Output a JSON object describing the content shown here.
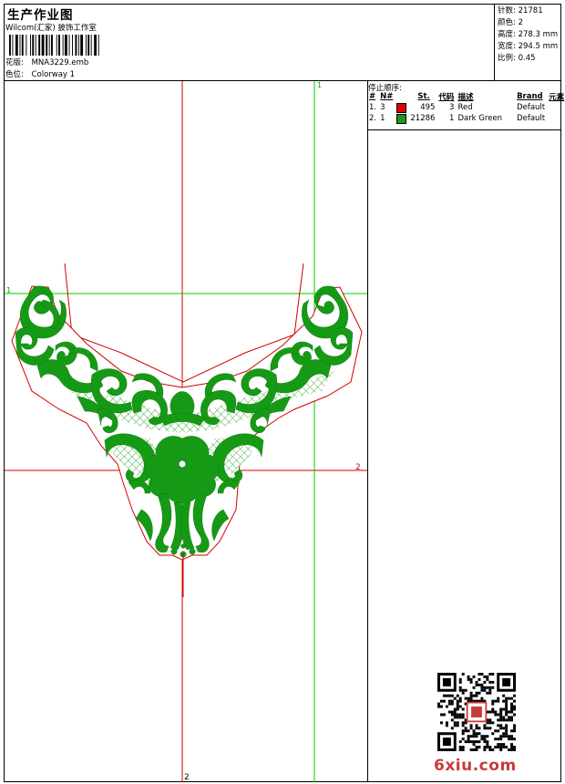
{
  "header": {
    "title": "生产作业图",
    "studio": "Wilcom(汇家) 披饰工作室",
    "design_label": "花版:",
    "design_file": "MNA3229.emb",
    "colorway_label": "色位:",
    "colorway": "Colorway 1"
  },
  "stats": [
    {
      "label": "针数:",
      "value": "21781"
    },
    {
      "label": "颜色:",
      "value": "2"
    },
    {
      "label": "高度:",
      "value": "278.3 mm"
    },
    {
      "label": "宽度:",
      "value": "294.5 mm"
    },
    {
      "label": "比例:",
      "value": "0.45"
    }
  ],
  "sequence": {
    "title": "停止顺序:",
    "headers": [
      "#",
      "N#",
      "St.",
      "代码",
      "描述",
      "Brand",
      "元素"
    ],
    "rows": [
      {
        "idx": "1.",
        "n": "3",
        "color": "#e00000",
        "stitches": "495",
        "code": "3",
        "desc": "Red",
        "brand": "Default"
      },
      {
        "idx": "2.",
        "n": "1",
        "color": "#1a9a1a",
        "stitches": "21286",
        "code": "1",
        "desc": "Dark Green",
        "brand": "Default"
      }
    ]
  },
  "guides": {
    "v1_label": "1",
    "h1_label": "1",
    "h2_label": "2",
    "v2_label": "2"
  },
  "colors": {
    "outline": "#d40000",
    "fill": "#169a16",
    "guide_red": "#d40000",
    "guide_green": "#00cc00"
  },
  "watermark": "6xiu.com"
}
